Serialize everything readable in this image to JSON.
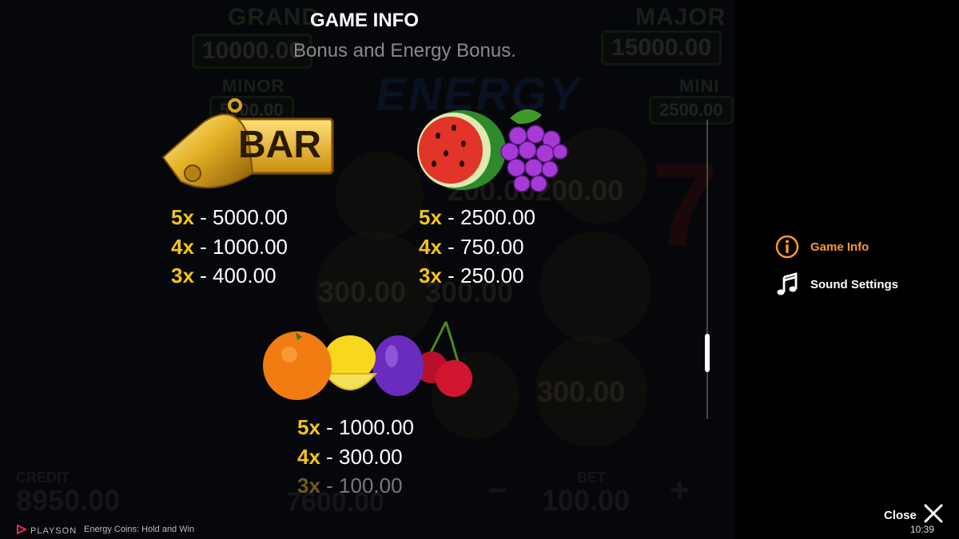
{
  "background": {
    "jackpots": [
      {
        "label": "GRAND",
        "value": "10000.00"
      },
      {
        "label": "MAJOR",
        "value": "15000.00"
      },
      {
        "label": "MINOR",
        "value": "5000.00"
      },
      {
        "label": "MINI",
        "value": "2500.00"
      }
    ],
    "logo": "ENERGY",
    "reel_values": [
      "200.00",
      "200.00",
      "300.00",
      "300.00",
      "300.00"
    ],
    "bottom": {
      "credit_label": "CREDIT",
      "credit_value": "8950.00",
      "win_value": "7600.00",
      "bet_label": "BET",
      "bet_value": "100.00",
      "minus": "−",
      "plus": "+"
    }
  },
  "info": {
    "title": "GAME INFO",
    "subtitle": "Bonus and Energy Bonus.",
    "symbols": [
      {
        "name": "bell-bar",
        "badge": "BAR",
        "pays": [
          {
            "mult": "5x",
            "value": "- 5000.00"
          },
          {
            "mult": "4x",
            "value": "- 1000.00"
          },
          {
            "mult": "3x",
            "value": "- 400.00"
          }
        ]
      },
      {
        "name": "watermelon-grapes",
        "pays": [
          {
            "mult": "5x",
            "value": "- 2500.00"
          },
          {
            "mult": "4x",
            "value": "- 750.00"
          },
          {
            "mult": "3x",
            "value": "- 250.00"
          }
        ]
      },
      {
        "name": "orange-lemon-plum-cherry",
        "pays": [
          {
            "mult": "5x",
            "value": "- 1000.00"
          },
          {
            "mult": "4x",
            "value": "- 300.00"
          },
          {
            "mult": "3x",
            "value": "- 100.00"
          }
        ]
      }
    ]
  },
  "menu": {
    "items": [
      {
        "label": "Game Info",
        "icon": "info-icon",
        "active": true
      },
      {
        "label": "Sound Settings",
        "icon": "music-note-icon",
        "active": false
      }
    ]
  },
  "footer": {
    "close_label": "Close",
    "clock": "10:39",
    "brand": "PLAYSON",
    "game_name": "Energy Coins: Hold and Win"
  },
  "colors": {
    "accent": "#f29a2e",
    "multiplier": "#f4c21c"
  }
}
